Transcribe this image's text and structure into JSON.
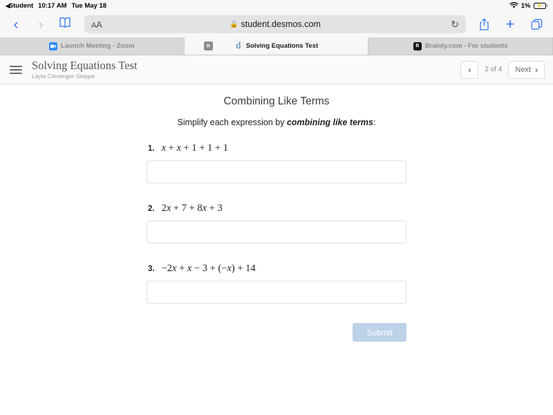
{
  "status_bar": {
    "back_label": "Student",
    "time": "10:17 AM",
    "date": "Tue May 18",
    "battery_percent": "1%",
    "wifi_icon": "wifi-icon",
    "battery_icon": "battery-charging-icon"
  },
  "browser": {
    "back_icon": "chevron-left-icon",
    "forward_icon": "chevron-right-icon",
    "bookmarks_icon": "book-icon",
    "text_size_label": "AA",
    "lock_icon": "lock-icon",
    "url": "student.desmos.com",
    "reload_icon": "reload-icon",
    "share_icon": "share-icon",
    "new_tab_icon": "plus-icon",
    "tabs_icon": "tabs-overview-icon",
    "tabs": [
      {
        "label": "Launch Meeting - Zoom",
        "favicon": "zoom-icon",
        "favicon_text": "",
        "active": false,
        "closable": false
      },
      {
        "label": "Solving Equations Test",
        "favicon": "desmos-icon",
        "favicon_text": "d",
        "active": true,
        "closable": true,
        "close_label": "✕"
      },
      {
        "label": "Brainly.com - For students",
        "favicon": "brainly-icon",
        "favicon_text": "B",
        "active": false,
        "closable": false
      }
    ]
  },
  "activity": {
    "menu_icon": "hamburger-menu-icon",
    "title": "Solving Equations Test",
    "student_name": "Layla Clevenger-Steppe",
    "prev_icon": "‹",
    "page_indicator": "2 of 4",
    "next_label": "Next",
    "next_icon": "›"
  },
  "main": {
    "screen_title": "Combining Like Terms",
    "prompt_prefix": "Simplify each expression by ",
    "prompt_emphasis": "combining like terms",
    "prompt_suffix": ":",
    "problems": [
      {
        "number": "1.",
        "expression": "x + x + 1 + 1 + 1",
        "answer": "",
        "placeholder": ""
      },
      {
        "number": "2.",
        "expression": "2x + 7 + 8x + 3",
        "answer": "",
        "placeholder": ""
      },
      {
        "number": "3.",
        "expression": "−2x + x − 3 + (−x) + 14",
        "answer": "",
        "placeholder": ""
      }
    ],
    "submit_label": "Submit"
  },
  "colors": {
    "accent_blue": "#3478f6",
    "submit_disabled": "#bdd2e8",
    "desmos_blue": "#2d70b3",
    "zoom_blue": "#2d8cff"
  }
}
